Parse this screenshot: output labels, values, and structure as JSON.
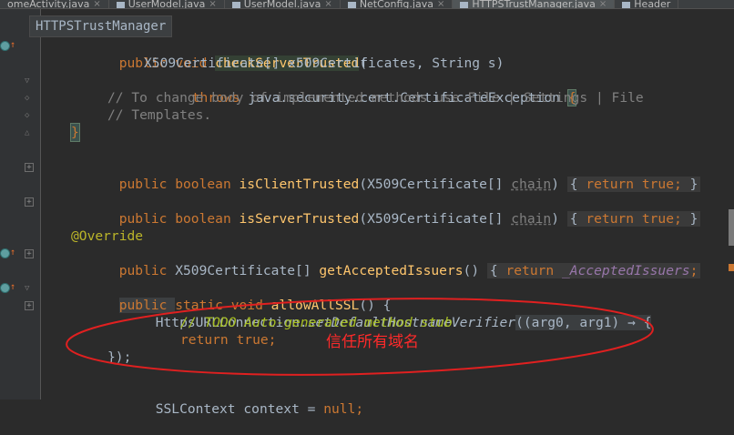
{
  "tabs": [
    {
      "label": "omeActivity.java",
      "active": false
    },
    {
      "label": "UserModel.java",
      "active": false
    },
    {
      "label": "UserModel.java",
      "active": false
    },
    {
      "label": "NetConfig.java",
      "active": false
    },
    {
      "label": "HTTPSTrustManager.java",
      "active": true
    },
    {
      "label": "Header",
      "active": false
    }
  ],
  "breadcrumb": "HTTPSTrustManager",
  "code": {
    "l1": {
      "kw": "public void ",
      "method": "checkServerTrusted",
      "rest": "("
    },
    "l2": {
      "text": "X509Certificate[] x509Certificates, String s)"
    },
    "l3": {
      "kw": "throws ",
      "text": "java.security.cert.CertificateException ",
      "brace": "{"
    },
    "l4": {
      "comment": "// To change body of implemented methods use File | Settings | File"
    },
    "l5": {
      "comment": "// Templates."
    },
    "l6": {
      "brace": "}"
    },
    "l7": {
      "kw": "public boolean ",
      "method": "isClientTrusted",
      "p1": "(X509Certificate[] ",
      "param": "chain",
      "p2": ") ",
      "fold_open": "{ ",
      "ret": "return true; ",
      "fold_close": "}"
    },
    "l8": {
      "kw": "public boolean ",
      "method": "isServerTrusted",
      "p1": "(X509Certificate[] ",
      "param": "chain",
      "p2": ") ",
      "fold_open": "{ ",
      "ret": "return true; ",
      "fold_close": "}"
    },
    "l9": {
      "anno": "@Override"
    },
    "l10": {
      "kw": "public ",
      "text": "X509Certificate[] ",
      "method": "getAcceptedIssuers",
      "rest": "() ",
      "fold_open": "{ ",
      "ret": "return ",
      "field": "_AcceptedIssuers",
      "end": ";"
    },
    "l11": {
      "kw1": "public ",
      "kw2": "static void ",
      "method": "allowAllSSL",
      "rest": "() {"
    },
    "l12": {
      "cls": "HttpsURLConnection.",
      "smethod": "setDefaultHostnameVerifier",
      "hint": "((arg0, arg1) → {"
    },
    "l13": {
      "todo": "// TODO Auto-generated method stub"
    },
    "l14": {
      "kw": "return true;"
    },
    "l15": {
      "text": "});"
    },
    "l16": {
      "text": "SSLContext context = ",
      "kw": "null",
      "end": ";"
    }
  },
  "annotation": {
    "text": "信任所有域名",
    "color": "#ff2a2a"
  },
  "colors": {
    "background": "#2b2b2b",
    "keyword": "#cc7832",
    "method": "#ffc66d",
    "comment": "#808080",
    "todo": "#a8c023",
    "annotation": "#bbb529",
    "field": "#9876aa",
    "text": "#a9b7c6"
  },
  "icons": {
    "override": "override-method-icon",
    "fold": "fold-toggle-icon"
  }
}
